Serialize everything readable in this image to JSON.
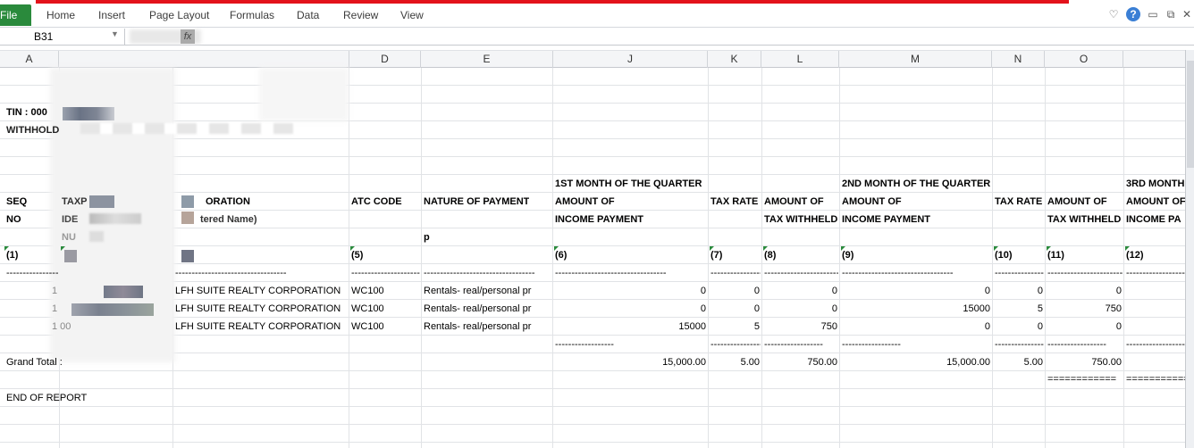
{
  "ribbon": {
    "file_label": "File",
    "tabs": [
      "Home",
      "Insert",
      "Page Layout",
      "Formulas",
      "Data",
      "Review",
      "View"
    ]
  },
  "formula_bar": {
    "name_box": "B31",
    "fx_label": "fx",
    "formula": ""
  },
  "columns": [
    "A",
    "D",
    "E",
    "J",
    "K",
    "L",
    "M",
    "N",
    "O"
  ],
  "sheet": {
    "tin_label": "TIN : 000",
    "withholding_label": "WITHHOLD",
    "header_1st_month": "1ST MONTH OF THE QUARTER",
    "header_2nd_month": "2ND MONTH OF THE QUARTER",
    "header_3rd_month": "3RD MONTH",
    "seq": "SEQ",
    "no": "NO",
    "taxp": "TAXP",
    "ide": "IDE",
    "nu": "NU",
    "corporation": "ORATION",
    "registered_name": "tered Name)",
    "atc_code": "ATC CODE",
    "nature_of_payment": "NATURE OF PAYMENT",
    "p": "p",
    "amount_of": "AMOUNT OF",
    "income_payment": "INCOME PAYMENT",
    "tax_rate": "TAX RATE",
    "tax_withheld": "TAX WITHHELD",
    "amount_of_3": "AMOUNT OF",
    "income_payment_3": "INCOME PA",
    "col_nums": [
      "(1)",
      "(5)",
      "(6)",
      "(7)",
      "(8)",
      "(9)",
      "(10)",
      "(11)",
      "(12)"
    ],
    "dash_short": "------------------",
    "dash_long": "----------------------------------",
    "rows": [
      {
        "seq": "1",
        "name": "LFH SUITE REALTY CORPORATION",
        "atc": "WC100",
        "nature": "Rentals-  real/personal pr",
        "m1_amount": "0",
        "m1_rate": "0",
        "m1_withheld": "0",
        "m2_amount": "0",
        "m2_rate": "0",
        "m2_withheld": "0"
      },
      {
        "seq": "1",
        "name": "LFH SUITE REALTY CORPORATION",
        "atc": "WC100",
        "nature": "Rentals-  real/personal pr",
        "m1_amount": "0",
        "m1_rate": "0",
        "m1_withheld": "0",
        "m2_amount": "15000",
        "m2_rate": "5",
        "m2_withheld": "750"
      },
      {
        "seq": "1 00",
        "name": "LFH SUITE REALTY CORPORATION",
        "atc": "WC100",
        "nature": "Rentals-  real/personal pr",
        "m1_amount": "15000",
        "m1_rate": "5",
        "m1_withheld": "750",
        "m2_amount": "0",
        "m2_rate": "0",
        "m2_withheld": "0"
      }
    ],
    "grand_total_label": "Grand Total :",
    "totals": {
      "m1_amount": "15,000.00",
      "m1_rate": "5.00",
      "m1_withheld": "750.00",
      "m2_amount": "15,000.00",
      "m2_rate": "5.00",
      "m2_withheld": "750.00"
    },
    "equals": "============",
    "end_of_report": "END OF REPORT"
  }
}
